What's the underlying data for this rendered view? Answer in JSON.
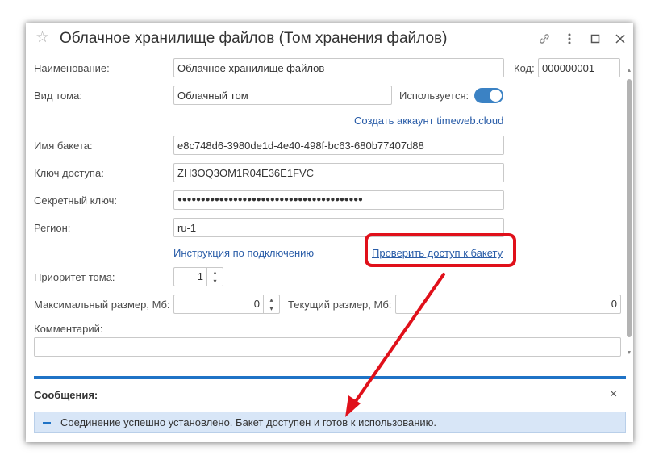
{
  "window": {
    "title": "Облачное хранилище файлов (Том хранения файлов)"
  },
  "form": {
    "name_label": "Наименование:",
    "name_value": "Облачное хранилище файлов",
    "code_label": "Код:",
    "code_value": "000000001",
    "volume_type_label": "Вид тома:",
    "volume_type_value": "Облачный том",
    "used_label": "Используется:",
    "used_on": true,
    "create_account_link": "Создать аккаунт timeweb.cloud",
    "bucket_label": "Имя бакета:",
    "bucket_value": "e8c748d6-3980de1d-4e40-498f-bc63-680b77407d88",
    "access_key_label": "Ключ доступа:",
    "access_key_value": "ZH3OQ3OM1R04E36E1FVC",
    "secret_key_label": "Секретный ключ:",
    "secret_key_value": "●●●●●●●●●●●●●●●●●●●●●●●●●●●●●●●●●●●●●●●●",
    "region_label": "Регион:",
    "region_value": "ru-1",
    "instruction_link": "Инструкция по подключению",
    "check_access_link": "Проверить доступ к бакету",
    "priority_label": "Приоритет тома:",
    "priority_value": "1",
    "max_size_label": "Максимальный размер, Мб:",
    "max_size_value": "0",
    "current_size_label": "Текущий размер, Мб:",
    "current_size_value": "0",
    "comment_label": "Комментарий:",
    "comment_value": ""
  },
  "messages": {
    "title": "Сообщения:",
    "close_glyph": "×",
    "items": [
      {
        "text": "Соединение успешно установлено. Бакет доступен и готов к использованию."
      }
    ]
  },
  "colors": {
    "accent": "#1f73c6",
    "link": "#2a5da8",
    "highlight": "#e0101a",
    "toggle": "#3b82c4"
  },
  "icons": [
    "star-icon",
    "link-icon",
    "more-icon",
    "maximize-icon",
    "close-icon"
  ]
}
